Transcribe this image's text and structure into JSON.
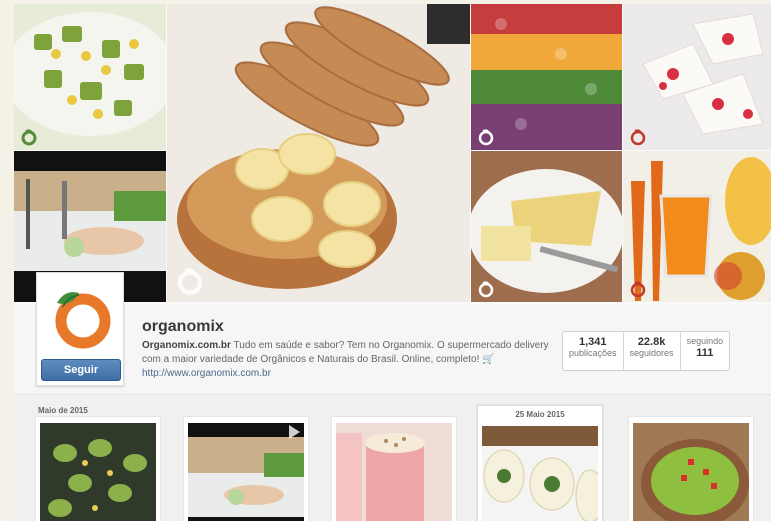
{
  "profile": {
    "username": "organomix",
    "bio_site": "Organomix.com.br",
    "bio_text": "Tudo em saúde e sabor? Tem no Organomix. O supermercado delivery com a maior variedade de Orgânicos e Naturais do Brasil. Online, completo! 🛒",
    "website": "http://www.organomix.com.br",
    "follow_label": "Seguir",
    "stats": [
      {
        "value": "1,341",
        "label": "publicações"
      },
      {
        "value": "22.8k",
        "label": "seguidores"
      },
      {
        "label": "seguindo",
        "value": "111"
      }
    ]
  },
  "feed": {
    "month_label": "Maio de 2015",
    "highlight_date": "25 Maio 2015"
  },
  "colors": {
    "brand_orange": "#e8792a",
    "brand_green": "#3e8e3a",
    "button_blue": "#4a78ad"
  },
  "icons": [
    "organomix-logo-icon",
    "organomix-badge-icon",
    "video-play-icon"
  ]
}
